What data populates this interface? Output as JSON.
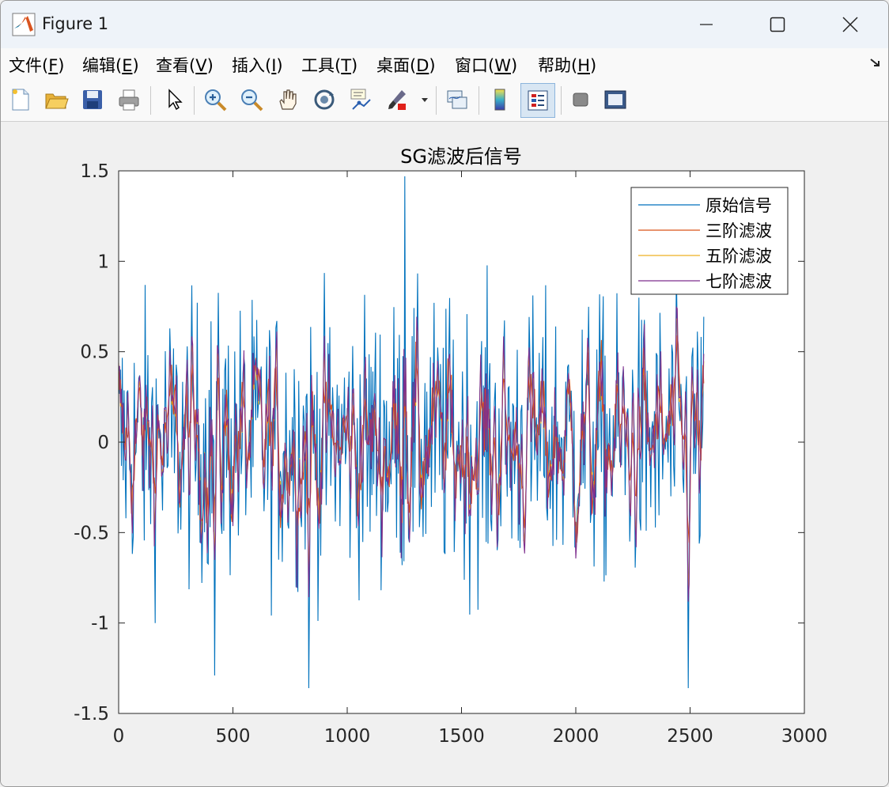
{
  "window": {
    "title": "Figure 1"
  },
  "menu": [
    {
      "label": "文件(",
      "key": "F",
      "tail": ")"
    },
    {
      "label": "编辑(",
      "key": "E",
      "tail": ")"
    },
    {
      "label": "查看(",
      "key": "V",
      "tail": ")"
    },
    {
      "label": "插入(",
      "key": "I",
      "tail": ")"
    },
    {
      "label": "工具(",
      "key": "T",
      "tail": ")"
    },
    {
      "label": "桌面(",
      "key": "D",
      "tail": ")"
    },
    {
      "label": "窗口(",
      "key": "W",
      "tail": ")"
    },
    {
      "label": "帮助(",
      "key": "H",
      "tail": ")"
    }
  ],
  "toolbar": [
    "new-figure-icon",
    "open-file-icon",
    "save-icon",
    "print-icon",
    "edit-plot-arrow-icon",
    "zoom-in-icon",
    "zoom-out-icon",
    "pan-hand-icon",
    "rotate-3d-icon",
    "data-cursor-icon",
    "brush-icon",
    "brush-dropdown-icon",
    "link-plot-icon",
    "insert-colorbar-icon",
    "insert-legend-icon",
    "hide-plot-tools-icon",
    "show-plot-tools-icon"
  ],
  "colors": {
    "original": "#0072BD",
    "third": "#D95319",
    "fifth": "#EDB120",
    "seventh": "#7E2F8E"
  },
  "chart_data": {
    "type": "line",
    "title": "SG滤波后信号",
    "xlabel": "",
    "ylabel": "",
    "xlim": [
      0,
      3000
    ],
    "ylim": [
      -1.5,
      1.5
    ],
    "xticks": [
      0,
      500,
      1000,
      1500,
      2000,
      2500,
      3000
    ],
    "yticks": [
      -1.5,
      -1,
      -0.5,
      0,
      0.5,
      1,
      1.5
    ],
    "xtick_labels": [
      "0",
      "500",
      "1000",
      "1500",
      "2000",
      "2500",
      "3000"
    ],
    "ytick_labels": [
      "-1.5",
      "-1",
      "-0.5",
      "0",
      "0.5",
      "1",
      "1.5"
    ],
    "legend_position": "top-right",
    "x_range_of_data": [
      0,
      2560
    ],
    "series": [
      {
        "name": "原始信号",
        "approx_abs_max": 1.47,
        "typical_amplitude": 0.6
      },
      {
        "name": "三阶滤波",
        "approx_abs_max": 0.8,
        "typical_amplitude": 0.3
      },
      {
        "name": "五阶滤波",
        "approx_abs_max": 0.8,
        "typical_amplitude": 0.3
      },
      {
        "name": "七阶滤波",
        "approx_abs_max": 0.88,
        "typical_amplitude": 0.3
      }
    ],
    "notable_points": [
      {
        "series": "原始信号",
        "x": 1250,
        "y": 1.47
      },
      {
        "series": "原始信号",
        "x": 830,
        "y": -1.36
      },
      {
        "series": "原始信号",
        "x": 2490,
        "y": -1.36
      },
      {
        "series": "原始信号",
        "x": 420,
        "y": -1.29
      },
      {
        "series": "七阶滤波",
        "x": 880,
        "y": 0.88
      },
      {
        "series": "五阶滤波",
        "x": 870,
        "y": -0.8
      }
    ]
  }
}
